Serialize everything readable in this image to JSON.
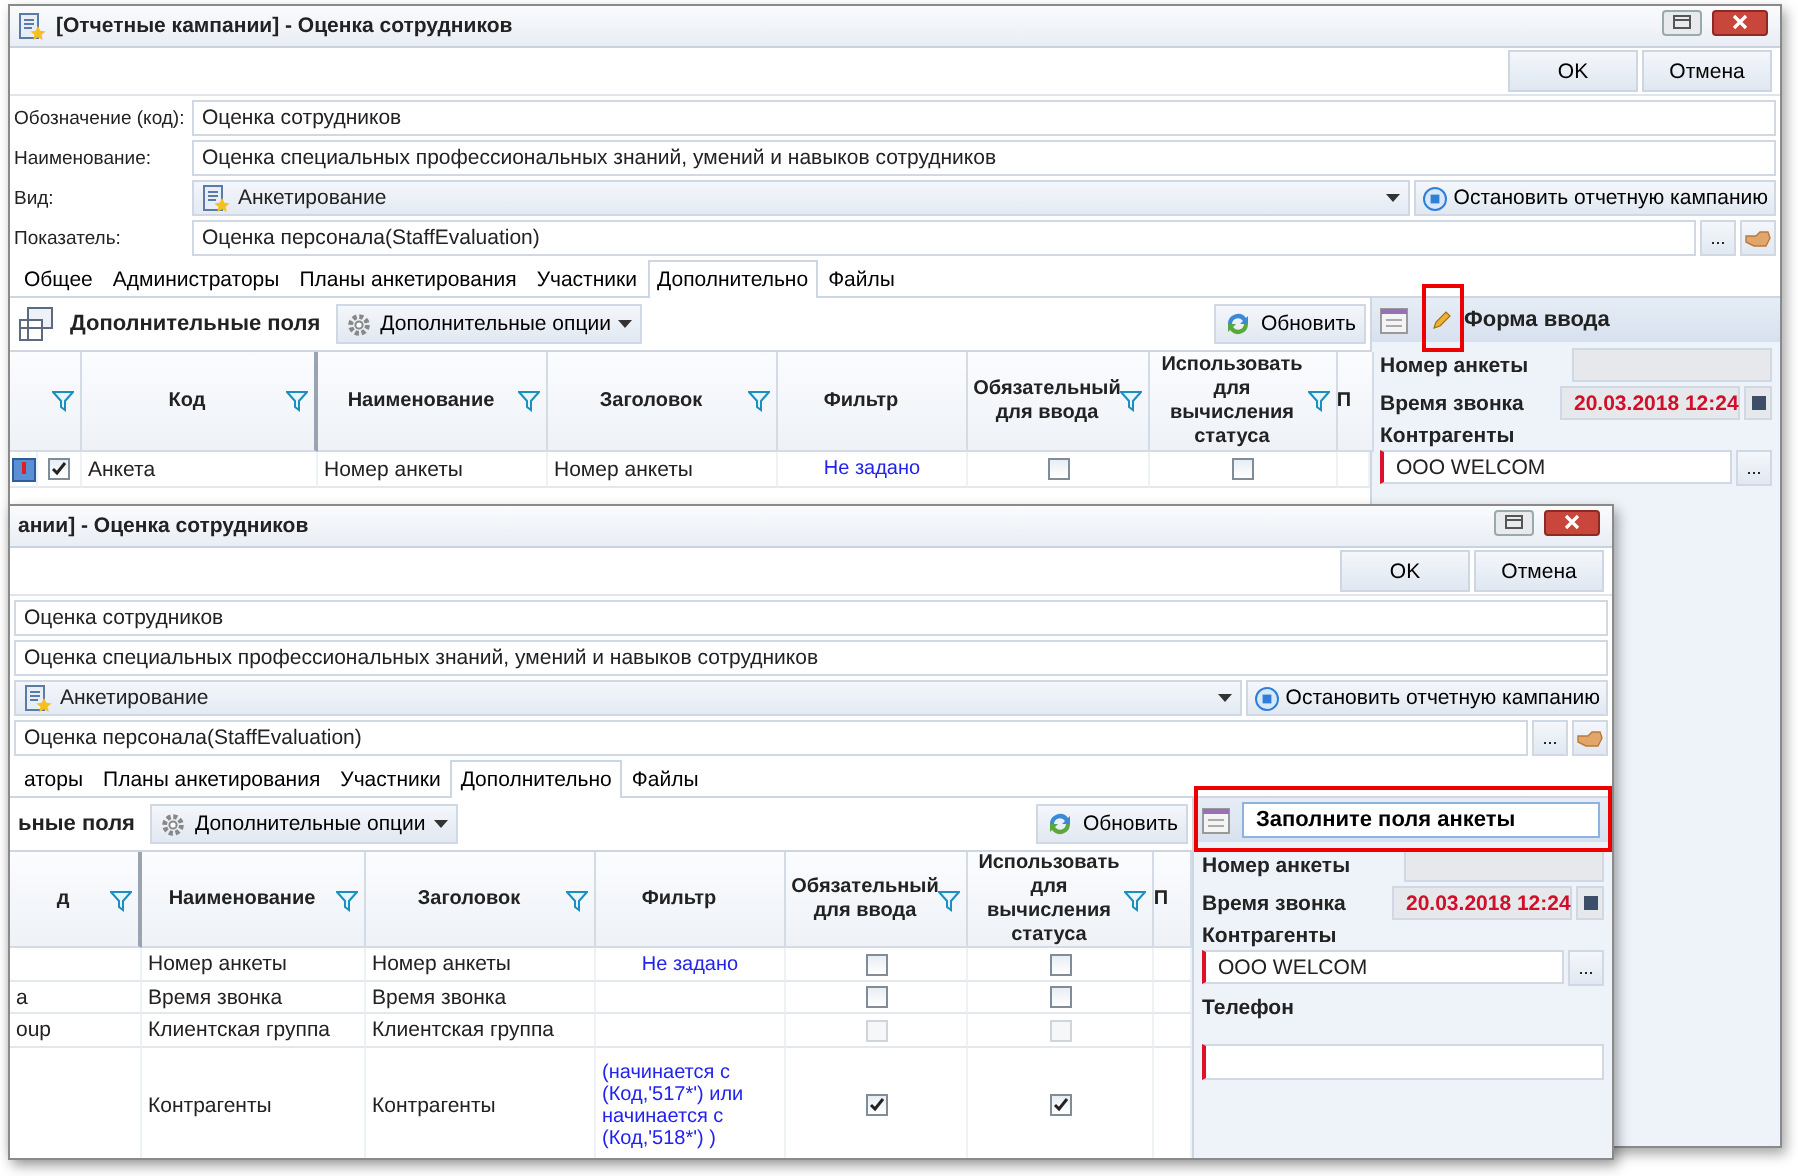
{
  "windows": [
    {
      "title": "[Отчетные кампании] - Оценка сотрудников",
      "buttons": [
        "OK",
        "Отмена"
      ],
      "fields": [
        {
          "label": "Обозначение (код):",
          "value": "Оценка сотрудников",
          "kind": "text"
        },
        {
          "label": "Наименование:",
          "value": "Оценка специальных профессиональных знаний, умений и навыков сотрудников",
          "kind": "text"
        },
        {
          "label": "Вид:",
          "value": "Анкетирование",
          "kind": "combo",
          "action": "Остановить отчетную кампанию"
        },
        {
          "label": "Показатель:",
          "value": "Оценка персонала(StaffEvaluation)",
          "kind": "lookup",
          "button": "..."
        }
      ],
      "tabs": [
        {
          "label": "Общее",
          "selected": false
        },
        {
          "label": "Администраторы",
          "selected": false
        },
        {
          "label": "Планы анкетирования",
          "selected": false
        },
        {
          "label": "Участники",
          "selected": false
        },
        {
          "label": "Дополнительно",
          "selected": true
        },
        {
          "label": "Файлы",
          "selected": false
        }
      ],
      "grid": {
        "title": "Дополнительные поля",
        "options": "Дополнительные опции",
        "refresh": "Обновить",
        "columns": [
          {
            "filter": false
          },
          {
            "filter": true
          },
          {
            "label": "Код",
            "filter": true
          },
          {
            "label": "Наименование",
            "filter": true
          },
          {
            "label": "Заголовок",
            "filter": true
          },
          {
            "label": "Фильтр",
            "filter": false
          },
          {
            "label": "Обязательный для ввода",
            "filter": true
          },
          {
            "label": "Использовать для вычисления статуса",
            "filter": true
          },
          {
            "label": "П",
            "filter": false
          }
        ],
        "rows": [
          {
            "cells": [
              {
                "kind": "icon"
              },
              {
                "kind": "check",
                "checked": true
              },
              {
                "kind": "text",
                "text": "Анкета"
              },
              {
                "kind": "text",
                "text": "Номер анкеты"
              },
              {
                "kind": "text",
                "text": "Номер анкеты"
              },
              {
                "kind": "link",
                "text": "Не задано"
              },
              {
                "kind": "box",
                "checked": false,
                "disabled": false
              },
              {
                "kind": "box",
                "checked": false,
                "disabled": false
              },
              {
                "kind": "text"
              }
            ]
          }
        ]
      },
      "form": {
        "title": "Форма ввода",
        "editing": false,
        "highlighted": true,
        "fields": [
          {
            "label": "Номер анкеты",
            "kind": "readonly",
            "required": false
          },
          {
            "label": "Время звонка",
            "kind": "date",
            "value": "20.03.2018 12:24",
            "required": false
          },
          {
            "label": "Контрагенты",
            "kind": "lookup",
            "value": "ООО WELCOM",
            "button": "...",
            "required": true
          }
        ]
      }
    },
    {
      "title": "ании] - Оценка сотрудников",
      "buttons": [
        "OK",
        "Отмена"
      ],
      "fields": [
        {
          "value": "Оценка сотрудников",
          "kind": "text"
        },
        {
          "value": "Оценка специальных профессиональных знаний, умений и навыков сотрудников",
          "kind": "text"
        },
        {
          "value": "Анкетирование",
          "kind": "combo",
          "action": "Остановить отчетную кампанию"
        },
        {
          "value": "Оценка персонала(StaffEvaluation)",
          "kind": "lookup",
          "button": "..."
        }
      ],
      "tabs": [
        {
          "label": "аторы",
          "selected": false
        },
        {
          "label": "Планы анкетирования",
          "selected": false
        },
        {
          "label": "Участники",
          "selected": false
        },
        {
          "label": "Дополнительно",
          "selected": true
        },
        {
          "label": "Файлы",
          "selected": false
        }
      ],
      "grid": {
        "title": "ьные поля",
        "options": "Дополнительные опции",
        "refresh": "Обновить",
        "columns": [
          {
            "label": "д",
            "filter": true
          },
          {
            "label": "Наименование",
            "filter": true
          },
          {
            "label": "Заголовок",
            "filter": true
          },
          {
            "label": "Фильтр",
            "filter": false
          },
          {
            "label": "Обязательный для ввода",
            "filter": true
          },
          {
            "label": "Использовать для вычисления статуса",
            "filter": true
          },
          {
            "label": "П",
            "filter": false
          }
        ],
        "rows": [
          {
            "cells": [
              {
                "kind": "text"
              },
              {
                "kind": "text",
                "text": "Номер анкеты"
              },
              {
                "kind": "text",
                "text": "Номер анкеты"
              },
              {
                "kind": "link",
                "text": "Не задано"
              },
              {
                "kind": "box",
                "checked": false,
                "disabled": false
              },
              {
                "kind": "box",
                "checked": false,
                "disabled": false
              },
              {
                "kind": "text"
              }
            ]
          },
          {
            "cells": [
              {
                "kind": "text",
                "text": "а"
              },
              {
                "kind": "text",
                "text": "Время звонка"
              },
              {
                "kind": "text",
                "text": "Время звонка"
              },
              {
                "kind": "link"
              },
              {
                "kind": "box",
                "checked": false,
                "disabled": false
              },
              {
                "kind": "box",
                "checked": false,
                "disabled": false
              },
              {
                "kind": "text"
              }
            ]
          },
          {
            "cells": [
              {
                "kind": "text",
                "text": "oup"
              },
              {
                "kind": "text",
                "text": "Клиентская группа"
              },
              {
                "kind": "text",
                "text": "Клиентская группа"
              },
              {
                "kind": "link"
              },
              {
                "kind": "box",
                "checked": false,
                "disabled": true
              },
              {
                "kind": "box",
                "checked": false,
                "disabled": true
              },
              {
                "kind": "text"
              }
            ]
          },
          {
            "cells": [
              {
                "kind": "text"
              },
              {
                "kind": "text",
                "text": "Контрагенты"
              },
              {
                "kind": "text",
                "text": "Контрагенты"
              },
              {
                "kind": "link",
                "text": "(начинается с (Код,'517*') или начинается с (Код,'518*') )"
              },
              {
                "kind": "box",
                "checked": true,
                "disabled": false
              },
              {
                "kind": "box",
                "checked": true,
                "disabled": false
              },
              {
                "kind": "text"
              }
            ]
          }
        ]
      },
      "form": {
        "title": "Заполните поля анкеты",
        "editing": true,
        "highlighted": true,
        "fields": [
          {
            "label": "Номер анкеты",
            "kind": "readonly",
            "required": false
          },
          {
            "label": "Время звонка",
            "kind": "date",
            "value": "20.03.2018 12:24",
            "required": false
          },
          {
            "label": "Контрагенты",
            "kind": "lookup",
            "value": "ООО WELCOM",
            "button": "...",
            "required": true
          },
          {
            "label": "Телефон",
            "kind": "text",
            "required": true
          }
        ]
      }
    }
  ]
}
